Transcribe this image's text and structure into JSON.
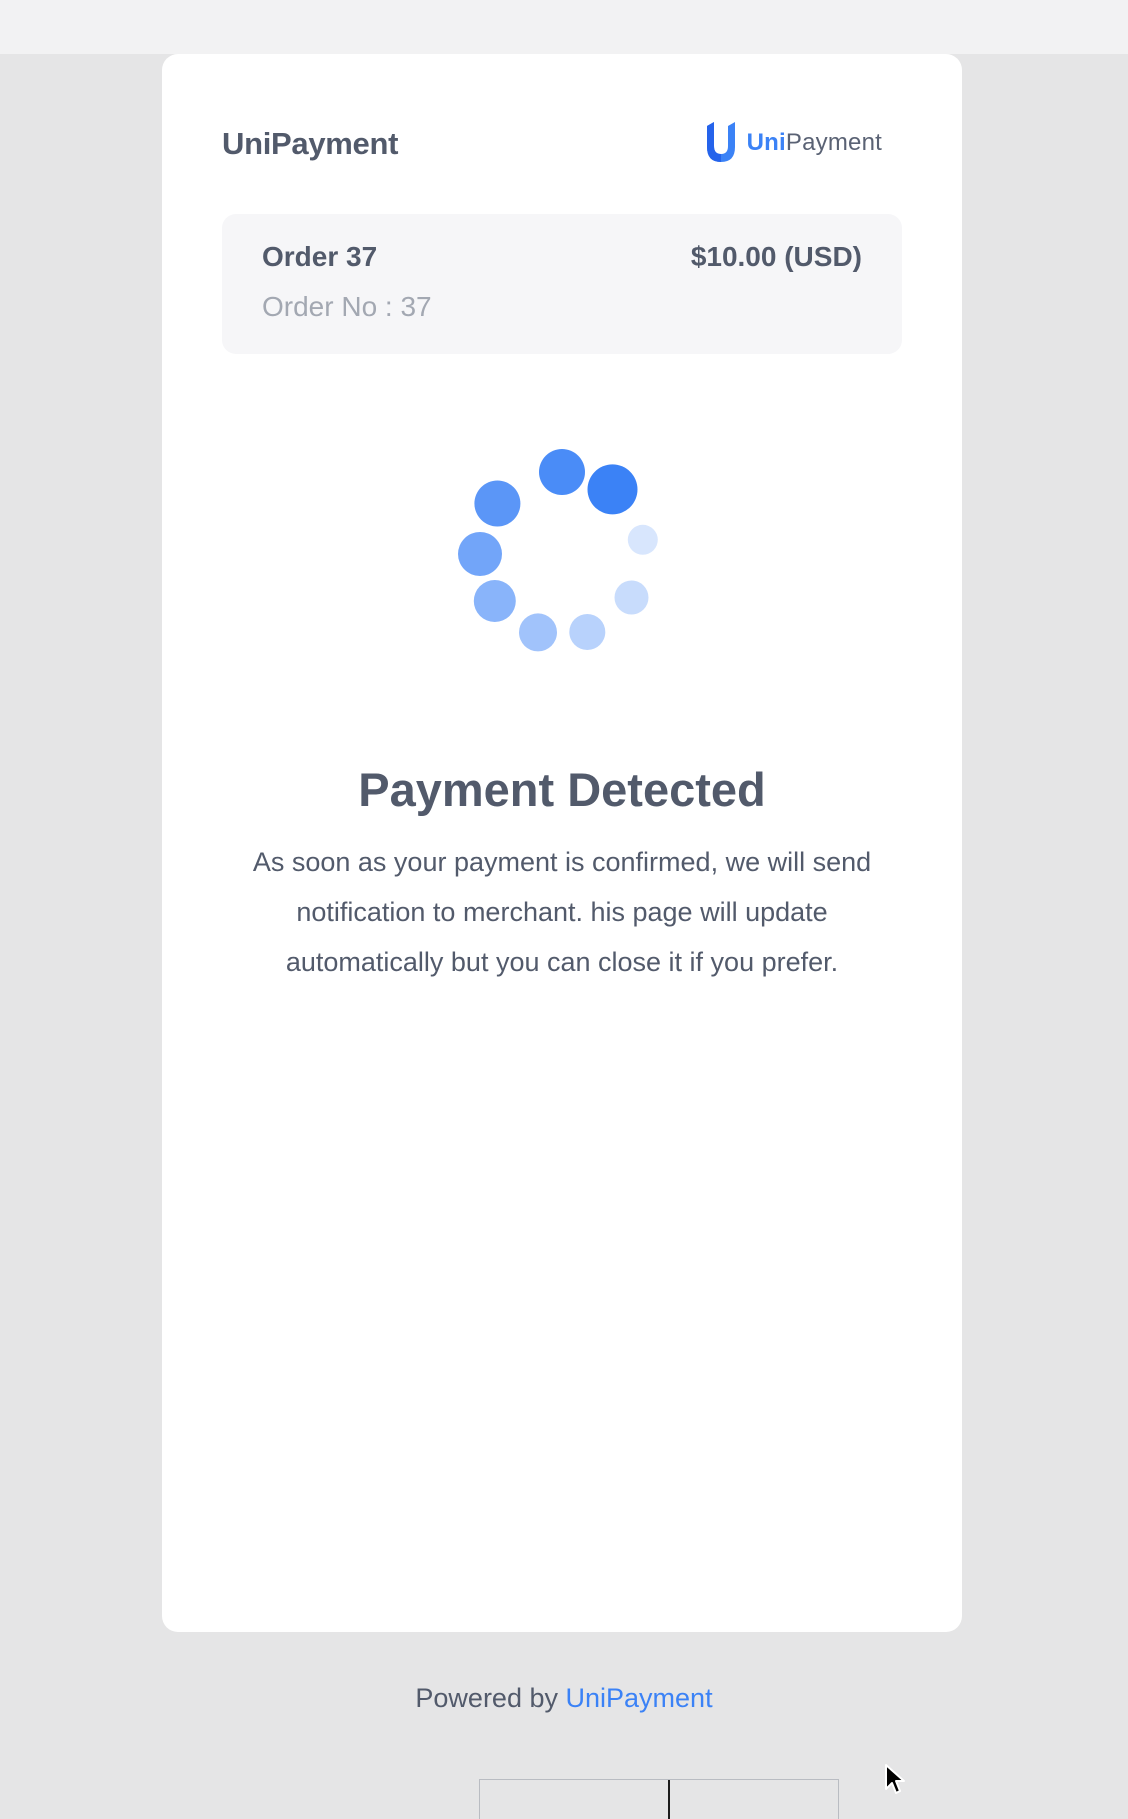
{
  "merchant": {
    "name": "UniPayment"
  },
  "brand": {
    "logo_uni": "Uni",
    "logo_payment": "Payment",
    "icon": "unipayment-logo-icon"
  },
  "order": {
    "title": "Order 37",
    "amount": "$10.00 (USD)",
    "number_label": "Order No : 37"
  },
  "status": {
    "icon": "loading-spinner-icon",
    "title": "Payment Detected",
    "message": "As soon as your payment is confirmed, we will send notification to merchant. his page will update automatically but you can close it if you prefer."
  },
  "footer": {
    "powered_prefix": "Powered by",
    "powered_link": "UniPayment"
  },
  "colors": {
    "accent": "#3b82f6",
    "text": "#525a6b",
    "muted": "#a3a8b2",
    "page_bg": "#e5e5e6"
  }
}
